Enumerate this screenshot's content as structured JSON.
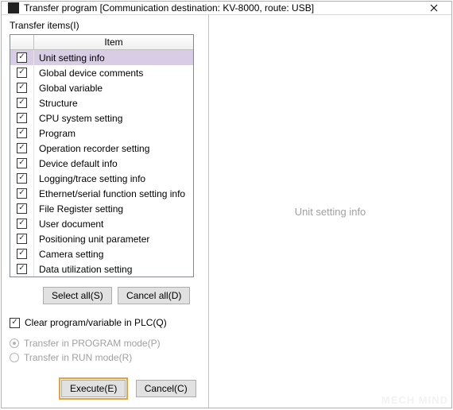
{
  "title": "Transfer program [Communication destination: KV-8000, route: USB]",
  "transferItemsLabel": "Transfer items(I)",
  "gridHeader": "Item",
  "items": [
    {
      "label": "Unit setting info",
      "checked": true,
      "selected": true
    },
    {
      "label": "Global device comments",
      "checked": true
    },
    {
      "label": "Global variable",
      "checked": true
    },
    {
      "label": "Structure",
      "checked": true
    },
    {
      "label": "CPU system setting",
      "checked": true
    },
    {
      "label": "Program",
      "checked": true
    },
    {
      "label": "Operation recorder setting",
      "checked": true
    },
    {
      "label": "Device default info",
      "checked": true
    },
    {
      "label": "Logging/trace setting info",
      "checked": true
    },
    {
      "label": "Ethernet/serial function setting info",
      "checked": true
    },
    {
      "label": "File Register setting",
      "checked": true
    },
    {
      "label": "User document",
      "checked": true
    },
    {
      "label": "Positioning unit parameter",
      "checked": true
    },
    {
      "label": "Camera setting",
      "checked": true
    },
    {
      "label": "Data utilization setting",
      "checked": true
    }
  ],
  "buttons": {
    "selectAll": "Select all(S)",
    "cancelAll": "Cancel all(D)",
    "execute": "Execute(E)",
    "cancel": "Cancel(C)"
  },
  "clearProgram": {
    "label": "Clear program/variable in PLC(Q)",
    "checked": true
  },
  "modes": {
    "program": {
      "label": "Transfer in PROGRAM mode(P)",
      "selected": true
    },
    "run": {
      "label": "Transfer in RUN mode(R)",
      "selected": false
    }
  },
  "preview": "Unit setting info",
  "watermark": "MECH MIND"
}
